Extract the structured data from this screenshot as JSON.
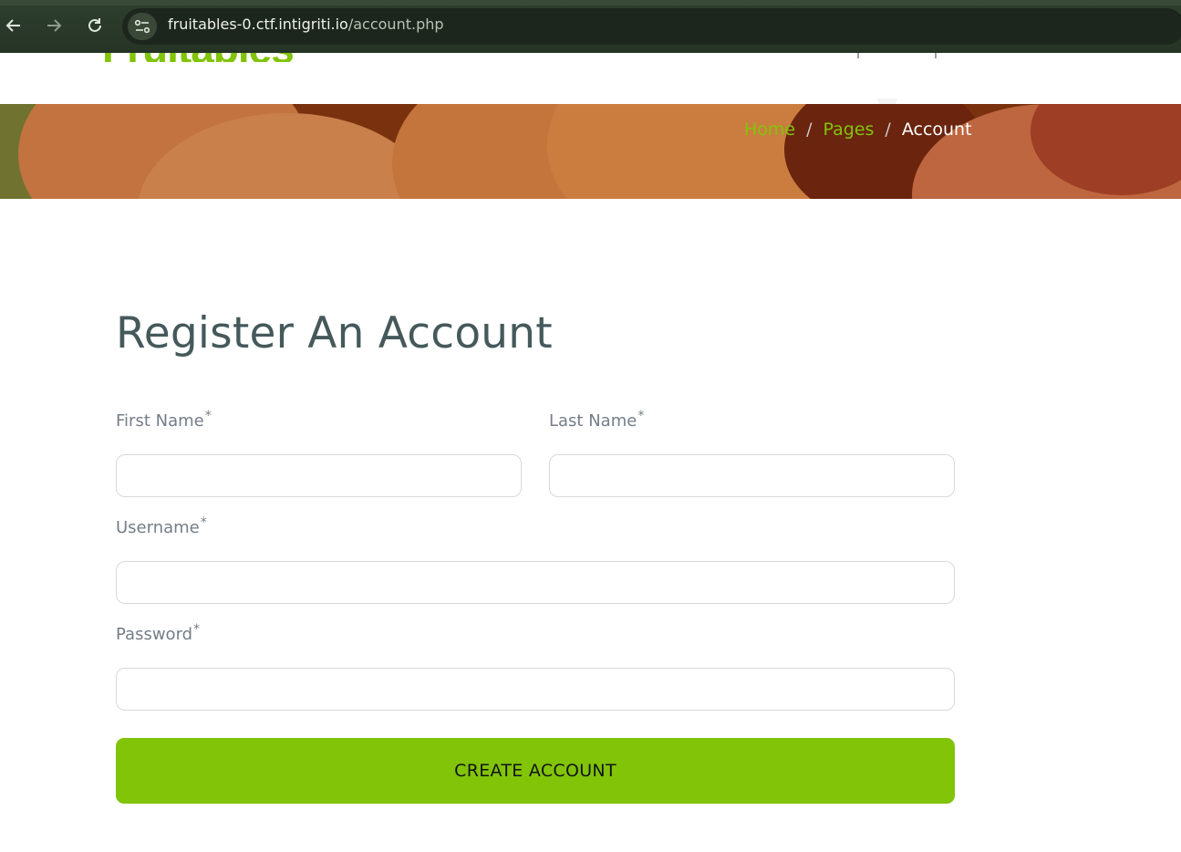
{
  "browser": {
    "url_host": "fruitables-0.ctf.intigriti.io",
    "url_path": "/account.php"
  },
  "header": {
    "logo": "Fruitables"
  },
  "breadcrumb": {
    "home": "Home",
    "pages": "Pages",
    "current": "Account",
    "separator": "/"
  },
  "form": {
    "title": "Register An Account",
    "first_name_label": "First Name",
    "last_name_label": "Last Name",
    "username_label": "Username",
    "password_label": "Password",
    "required_mark": "*",
    "first_name_value": "",
    "last_name_value": "",
    "username_value": "",
    "password_value": "",
    "submit_label": "CREATE ACCOUNT"
  },
  "colors": {
    "brand_green": "#81c408",
    "title_color": "#45595b",
    "label_color": "#747d88"
  }
}
